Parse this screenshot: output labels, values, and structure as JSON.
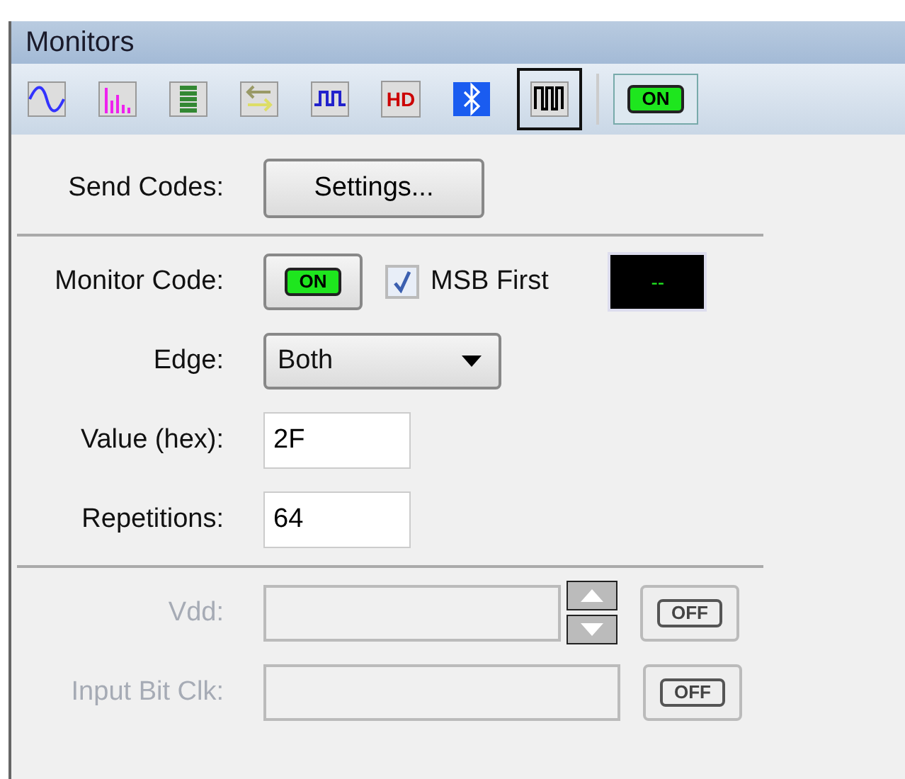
{
  "window": {
    "title": "Monitors"
  },
  "toolbar": {
    "tools": [
      {
        "kind": "wave",
        "selected": false
      },
      {
        "kind": "spectrum",
        "selected": false
      },
      {
        "kind": "list",
        "selected": false
      },
      {
        "kind": "swap",
        "selected": false
      },
      {
        "kind": "pulse",
        "selected": false
      },
      {
        "kind": "hd",
        "label": "HD",
        "selected": false
      },
      {
        "kind": "bluetooth",
        "selected": false
      },
      {
        "kind": "bits",
        "selected": true
      }
    ],
    "toggle": {
      "label": "ON",
      "on": true
    }
  },
  "send_codes": {
    "label": "Send Codes:",
    "button": "Settings..."
  },
  "monitor_code": {
    "label": "Monitor Code:",
    "toggle": {
      "label": "ON",
      "on": true
    },
    "msb_first": {
      "label": "MSB First",
      "checked": true
    },
    "display": "--"
  },
  "edge": {
    "label": "Edge:",
    "value": "Both"
  },
  "value_hex": {
    "label": "Value (hex):",
    "value": "2F"
  },
  "repetitions": {
    "label": "Repetitions:",
    "value": "64"
  },
  "vdd": {
    "label": "Vdd:",
    "disabled": true,
    "toggle": {
      "label": "OFF",
      "on": false
    }
  },
  "input_bit_clk": {
    "label": "Input Bit Clk:",
    "disabled": true,
    "toggle": {
      "label": "OFF",
      "on": false
    }
  }
}
